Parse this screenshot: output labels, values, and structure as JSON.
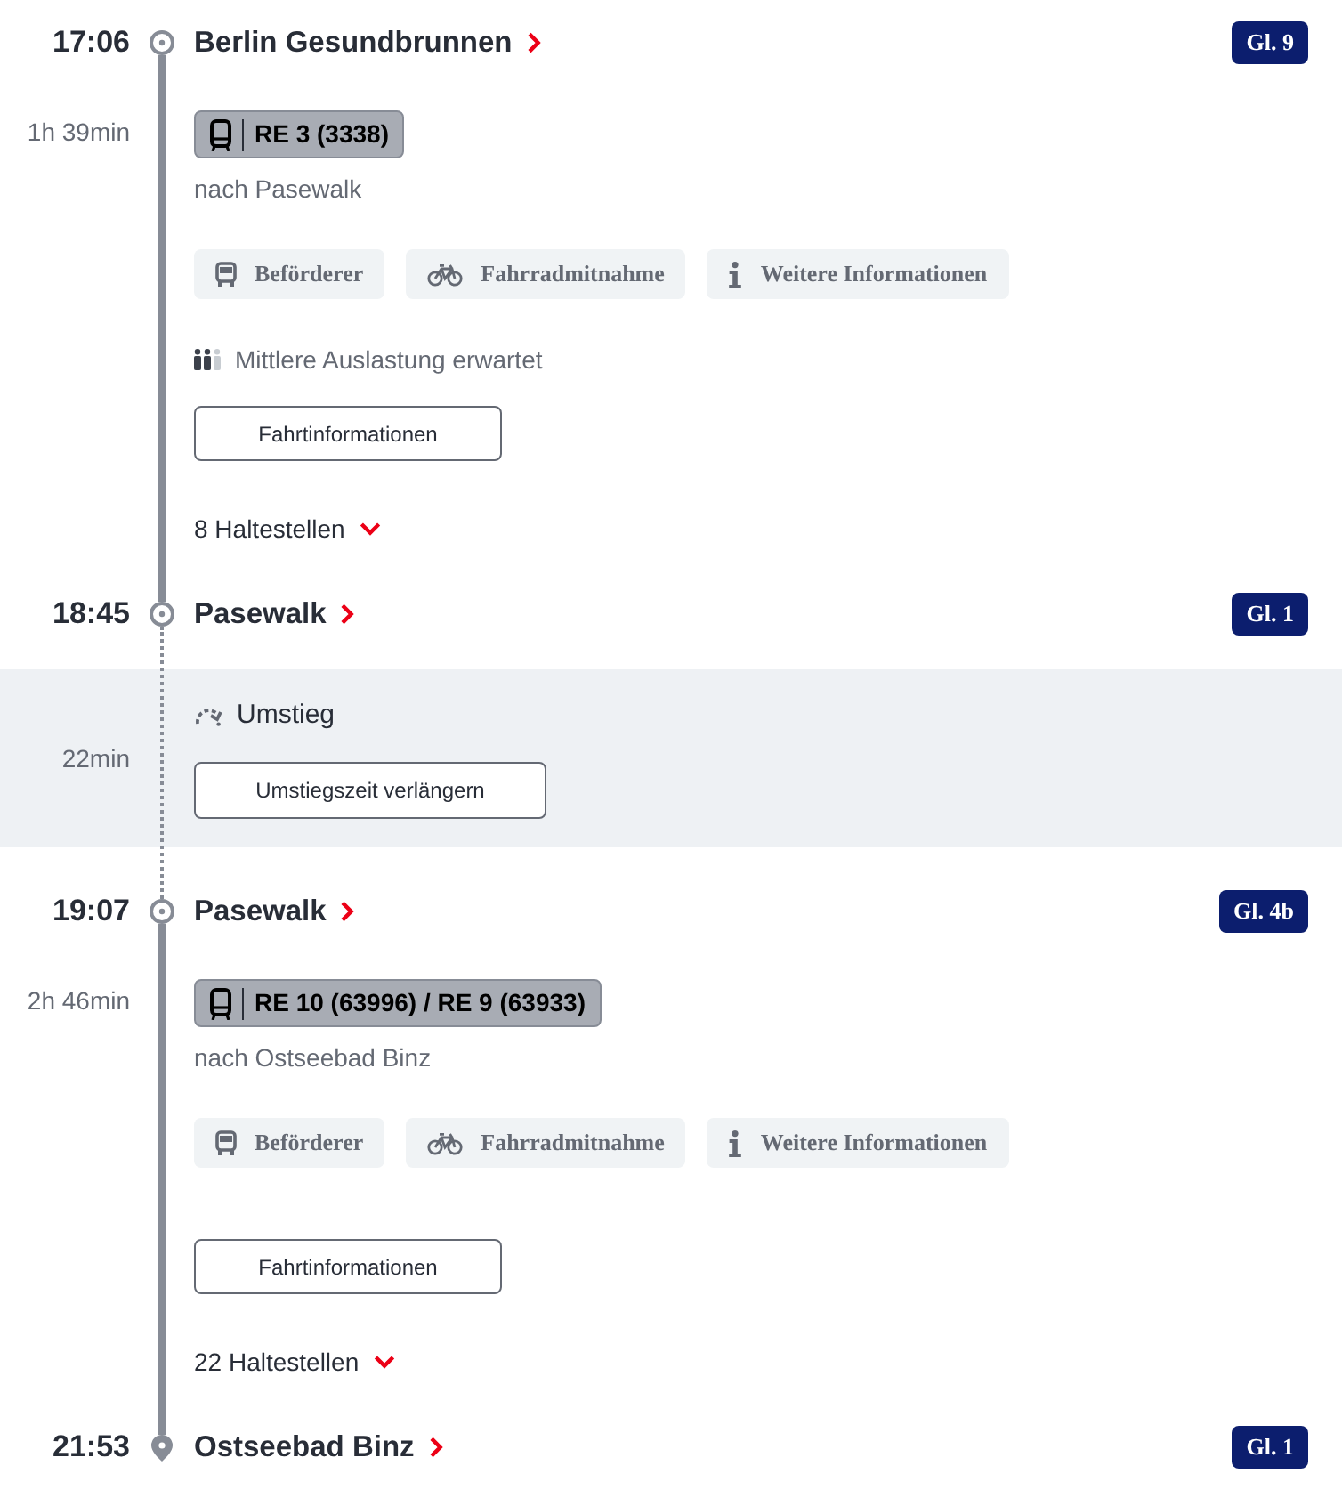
{
  "journey": [
    {
      "kind": "stop",
      "time": "17:06",
      "station": "Berlin Gesundbrunnen",
      "platform": "Gl. 9",
      "destination": false
    },
    {
      "kind": "leg",
      "duration": "1h 39min",
      "train": "RE 3 (3338)",
      "direction": "nach Pasewalk",
      "chips": [
        {
          "kind": "operator",
          "label": "Beförderer"
        },
        {
          "kind": "bike",
          "label": "Fahrradmitnahme"
        },
        {
          "kind": "info",
          "label": "Weitere Informationen"
        }
      ],
      "occupancy": {
        "text": "Mittlere Auslastung erwartet",
        "level": 0.67
      },
      "details_button": "Fahrtinformationen",
      "stops_toggle": {
        "label": "8 Haltestellen",
        "expanded": false
      }
    },
    {
      "kind": "stop",
      "time": "18:45",
      "station": "Pasewalk",
      "platform": "Gl. 1",
      "destination": false
    },
    {
      "kind": "transfer",
      "label": "Umstieg",
      "duration": "22min",
      "button": "Umstiegszeit verlängern"
    },
    {
      "kind": "stop",
      "time": "19:07",
      "station": "Pasewalk",
      "platform": "Gl. 4b",
      "destination": false
    },
    {
      "kind": "leg",
      "duration": "2h 46min",
      "train": "RE 10 (63996) / RE 9 (63933)",
      "direction": "nach Ostseebad Binz",
      "chips": [
        {
          "kind": "operator",
          "label": "Beförderer"
        },
        {
          "kind": "bike",
          "label": "Fahrradmitnahme"
        },
        {
          "kind": "info",
          "label": "Weitere Informationen"
        }
      ],
      "details_button": "Fahrtinformationen",
      "stops_toggle": {
        "label": "22 Haltestellen",
        "expanded": false
      }
    },
    {
      "kind": "stop",
      "time": "21:53",
      "station": "Ostseebad Binz",
      "platform": "Gl. 1",
      "destination": true
    }
  ]
}
